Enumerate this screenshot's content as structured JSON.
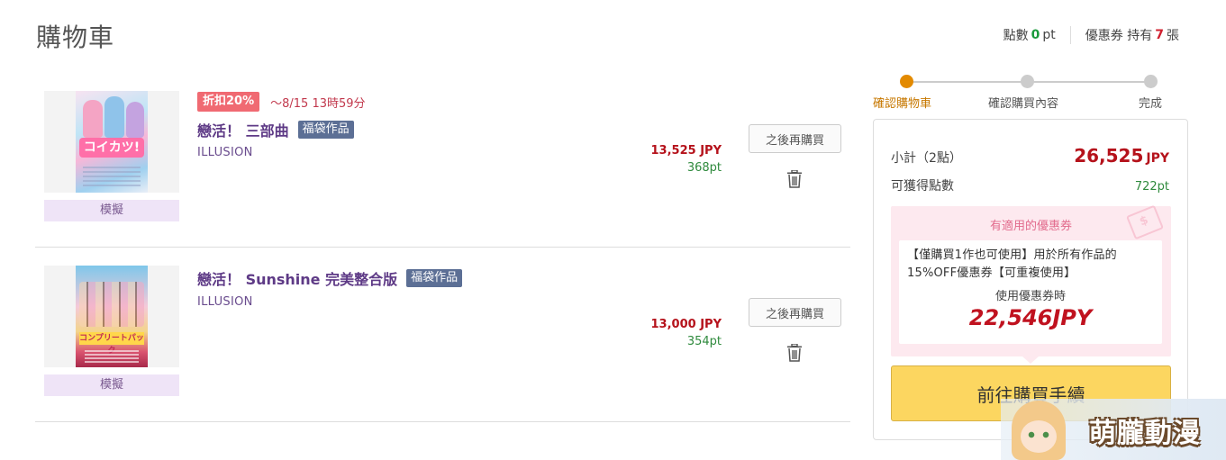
{
  "page": {
    "title": "購物車"
  },
  "header": {
    "points_label": "點數",
    "points_value": "0",
    "points_unit": "pt",
    "coupon_label": "優惠券 持有",
    "coupon_count": "7",
    "coupon_unit": "張"
  },
  "cart": {
    "items": [
      {
        "discount_tag": "折扣20%",
        "discount_until": "～8/15 13時59分",
        "title": "戀活！ 三部曲",
        "tag": "福袋作品",
        "maker": "ILLUSION",
        "thumb_text": "コイカツ!",
        "category": "模擬",
        "price": "13,525 JPY",
        "points": "368pt",
        "later_label": "之後再購買"
      },
      {
        "title": "戀活！ Sunshine 完美整合版",
        "tag": "福袋作品",
        "maker": "ILLUSION",
        "thumb_text": "コンプリートパック",
        "category": "模擬",
        "price": "13,000 JPY",
        "points": "354pt",
        "later_label": "之後再購買"
      }
    ]
  },
  "steps": [
    {
      "label": "確認購物車",
      "active": true
    },
    {
      "label": "確認購買內容",
      "active": false
    },
    {
      "label": "完成",
      "active": false
    }
  ],
  "summary": {
    "subtotal_label": "小計（2點）",
    "subtotal_value": "26,525",
    "subtotal_unit": "JPY",
    "points_label": "可獲得點數",
    "points_value": "722pt",
    "coupon_title": "有適用的優惠券",
    "coupon_desc": "【僅購買1作也可使用】用於所有作品的15%OFF優惠券【可重複使用】",
    "coupon_use_label": "使用優惠券時",
    "coupon_price": "22,546JPY",
    "checkout_label": "前往購買手續"
  },
  "watermark": {
    "text": "萌朧動漫"
  },
  "colors": {
    "price_red": "#b5121b",
    "points_green": "#2f8a3d",
    "step_active": "#e38a00",
    "checkout_yellow": "#fcd660",
    "title_purple": "#5e3a86"
  }
}
